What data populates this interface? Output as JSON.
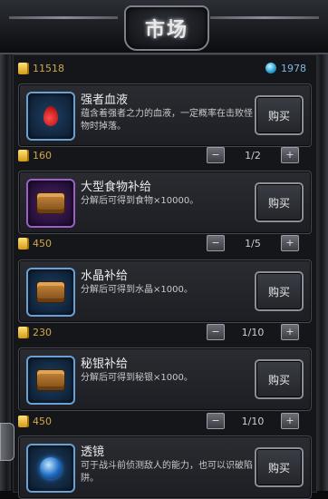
{
  "header": {
    "title": "市场"
  },
  "currency": {
    "gold": "11518",
    "gems": "1978"
  },
  "items": [
    {
      "name": "强者血液",
      "desc": "蕴含着强者之力的血液，一定概率在击败怪物时掉落。",
      "icon": "blood-drop-icon",
      "buy_label": "购买",
      "price": "160",
      "page": "1/2"
    },
    {
      "name": "大型食物补给",
      "desc": "分解后可得到食物×10000。",
      "icon": "supply-chest-icon",
      "buy_label": "购买",
      "price": "450",
      "page": "1/5"
    },
    {
      "name": "水晶补给",
      "desc": "分解后可得到水晶×1000。",
      "icon": "supply-chest-icon",
      "buy_label": "购买",
      "price": "230",
      "page": "1/10"
    },
    {
      "name": "秘银补给",
      "desc": "分解后可得到秘银×1000。",
      "icon": "supply-chest-icon",
      "buy_label": "购买",
      "price": "450",
      "page": "1/10"
    },
    {
      "name": "透镜",
      "desc": "可于战斗前侦测敌人的能力，也可以识破陷阱。",
      "icon": "lens-orb-icon",
      "buy_label": "购买"
    }
  ],
  "stepper": {
    "minus": "−",
    "plus": "+"
  }
}
